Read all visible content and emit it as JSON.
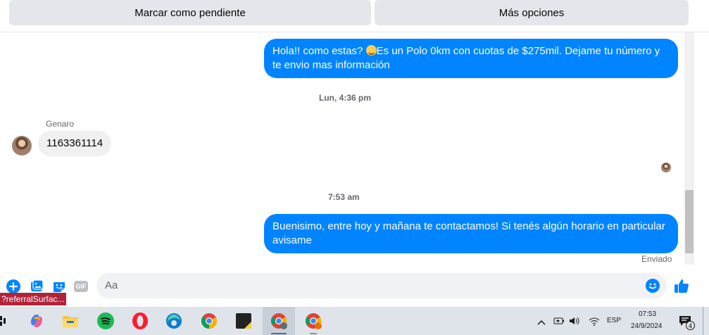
{
  "top_buttons": {
    "mark_pending": "Marcar como pendiente",
    "more_options": "Más opciones"
  },
  "messages": {
    "outgoing_1_before_emoji": "Hola!! como estas? ",
    "outgoing_1_after_emoji": "Es un Polo 0km con cuotas de $275mil. Dejame tu número y te envio mas información",
    "timestamp_1": "Lun, 4:36 pm",
    "sender_name": "Genaro",
    "incoming_1": "1163361114",
    "timestamp_2": "7:53 am",
    "outgoing_2": "Buenisimo, entre hoy y mañana te contactamos! Si tenés algún horario en particular avisame",
    "status": "Enviado"
  },
  "composer": {
    "placeholder": "Aa",
    "gif_label": "GIF"
  },
  "ref_tag": "?referralSurfac...",
  "taskbar": {
    "language": "ESP",
    "time": "07:53",
    "date": "24/9/2024",
    "notification_count": "4"
  },
  "colors": {
    "messenger_blue": "#0084ff",
    "bubble_gray": "#f0f0f0",
    "button_gray": "#e4e6eb",
    "ref_tag_red": "#b0243a",
    "taskbar_bg": "#dfe3ea"
  }
}
